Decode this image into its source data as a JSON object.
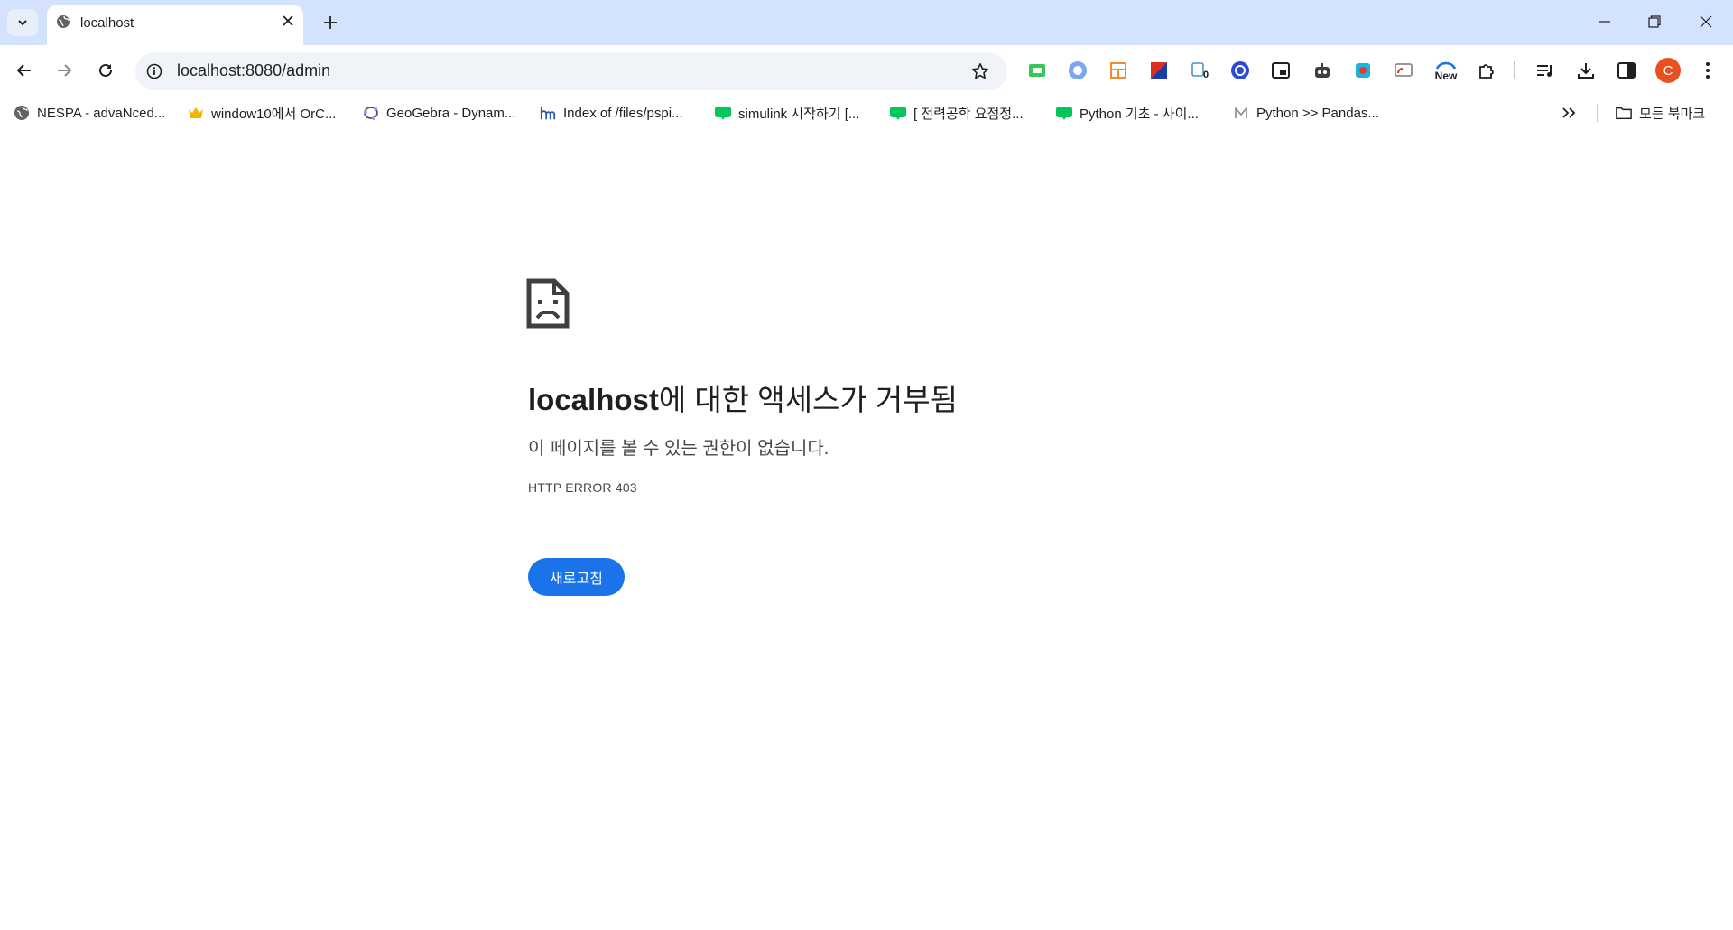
{
  "browser": {
    "tab": {
      "title": "localhost"
    },
    "address_bar": {
      "url": "localhost:8080/admin"
    },
    "profile_initial": "C",
    "extension_badges": {
      "count": "0",
      "new": "New"
    },
    "bookmarks": [
      {
        "label": "NESPA - advaNced...",
        "icon": "globe-icon"
      },
      {
        "label": "window10에서 OrC...",
        "icon": "crown-icon"
      },
      {
        "label": "GeoGebra - Dynam...",
        "icon": "geogebra-icon"
      },
      {
        "label": "Index of /files/pspi...",
        "icon": "hm-icon"
      },
      {
        "label": "simulink 시작하기 [...",
        "icon": "blog-icon"
      },
      {
        "label": "[ 전력공학 요점정...",
        "icon": "blog-icon"
      },
      {
        "label": "Python 기초 - 사이...",
        "icon": "blog-icon"
      },
      {
        "label": "Python >> Pandas...",
        "icon": "m-icon"
      }
    ],
    "all_bookmarks_label": "모든 북마크"
  },
  "page": {
    "title_host": "localhost",
    "title_rest": "에 대한 액세스가 거부됨",
    "subtitle": "이 페이지를 볼 수 있는 권한이 없습니다.",
    "error_code": "HTTP ERROR 403",
    "reload_label": "새로고침"
  },
  "colors": {
    "tabstrip": "#d3e3fd",
    "omnibox": "#f0f3f8",
    "button_blue": "#1a73e8",
    "profile_orange": "#e8501d",
    "blog_green": "#03c75a"
  }
}
